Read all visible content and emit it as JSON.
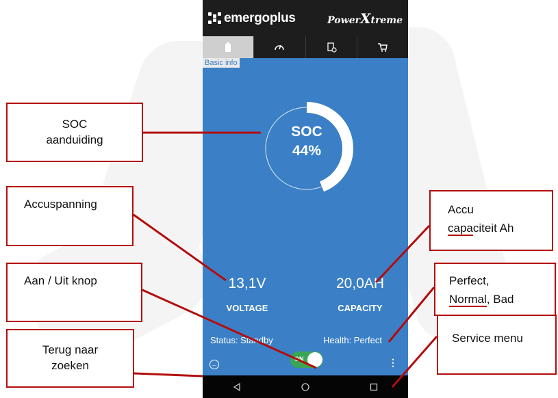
{
  "app": {
    "brand_left": "emergoplus",
    "brand_right_prefix": "Power",
    "brand_right_x": "X",
    "brand_right_suffix": "treme"
  },
  "tabs": [
    {
      "icon": "battery-icon",
      "active": true
    },
    {
      "icon": "gauge-icon",
      "active": false
    },
    {
      "icon": "document-icon",
      "active": false
    },
    {
      "icon": "cart-icon",
      "active": false
    }
  ],
  "main": {
    "section_label": "Basic info",
    "soc_label": "SOC",
    "soc_value": "44%",
    "soc_fraction": 0.44,
    "voltage_value": "13,1V",
    "voltage_label": "VOLTAGE",
    "capacity_value": "20,0AH",
    "capacity_label": "CAPACITY",
    "status": "Status: Standby",
    "health": "Health: Perfect",
    "toggle_label": "ON",
    "menu_glyph": "⋮",
    "back_glyph": "←"
  },
  "colors": {
    "content_bg": "#3b80c6",
    "header_bg": "#1d1d1d",
    "callout_border": "#b30c0c",
    "toggle_on": "#3aa655"
  },
  "callouts": {
    "soc_line1": "SOC",
    "soc_line2": "aanduiding",
    "accuspanning": "Accuspanning",
    "aan_uit": "Aan / Uit knop",
    "terug_line1": "Terug naar",
    "terug_line2": "zoeken",
    "accu_line1": "Accu",
    "accu_capa": "capa",
    "accu_rest": "citeit Ah",
    "perfect_line1": "Perfect,",
    "perfect_normal": "Normal",
    "perfect_rest": ", Bad",
    "service": "Service menu"
  }
}
